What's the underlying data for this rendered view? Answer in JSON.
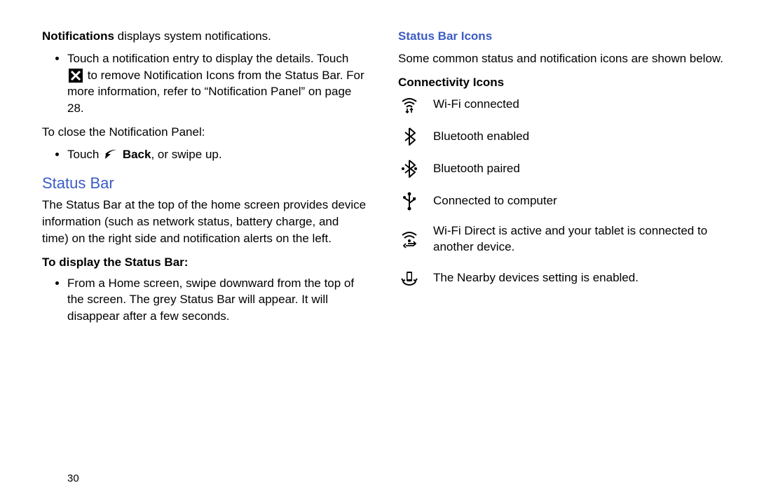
{
  "left": {
    "notif_line_a": "Notifications",
    "notif_line_b": " displays system notifications.",
    "bullet1_a": "Touch a notification entry to display the details. Touch ",
    "bullet1_b": " to remove Notification Icons from the Status Bar. For more information, refer to ",
    "bullet1_c": " “Notification Panel” ",
    "bullet1_d": "on page 28.",
    "close_line": "To close the Notification Panel:",
    "bullet2_a": "Touch ",
    "bullet2_b": "Back",
    "bullet2_c": ", or swipe up.",
    "status_bar_heading": "Status Bar",
    "status_bar_body": "The Status Bar at the top of the home screen provides device information (such as network status, battery charge, and time) on the right side and notification alerts on the left.",
    "display_subhead": "To display the Status Bar:",
    "display_bullet": "From a Home screen, swipe downward from the top of the screen. The grey Status Bar will appear. It will disappear after a few seconds."
  },
  "right": {
    "heading": "Status Bar Icons",
    "intro": "Some common status and notification icons are shown below.",
    "connectivity_heading": "Connectivity Icons",
    "icons": [
      {
        "name": "wifi-icon",
        "label": "Wi-Fi connected"
      },
      {
        "name": "bluetooth-enabled-icon",
        "label": "Bluetooth enabled"
      },
      {
        "name": "bluetooth-paired-icon",
        "label": "Bluetooth paired"
      },
      {
        "name": "usb-icon",
        "label": "Connected to computer"
      },
      {
        "name": "wifi-direct-icon",
        "label": "Wi-Fi Direct is active and your tablet is connected to another device."
      },
      {
        "name": "nearby-devices-icon",
        "label": "The Nearby devices setting is enabled."
      }
    ]
  },
  "page_number": "30"
}
